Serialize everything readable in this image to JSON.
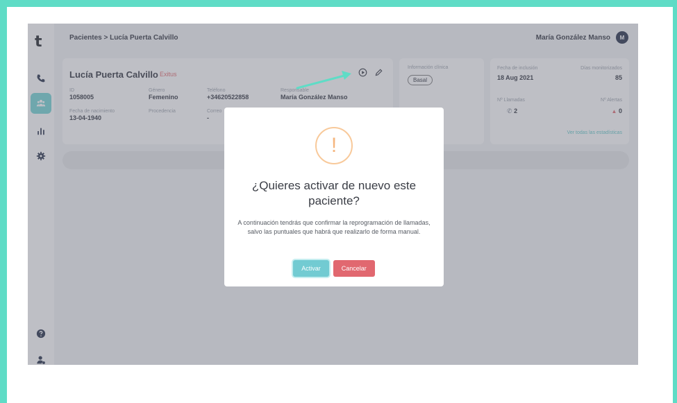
{
  "sidebar": {
    "logo": "t",
    "items": [
      {
        "name": "phone-icon"
      },
      {
        "name": "patients-icon",
        "active": true
      },
      {
        "name": "chart-icon"
      },
      {
        "name": "gear-icon"
      }
    ],
    "bottom_items": [
      {
        "name": "help-icon"
      },
      {
        "name": "user-settings-icon"
      }
    ]
  },
  "header": {
    "breadcrumb": "Pacientes > Lucía Puerta Calvillo",
    "user_name": "María González Manso",
    "avatar_initial": "M"
  },
  "patient": {
    "name": "Lucía Puerta Calvillo",
    "status": "Exitus",
    "fields": {
      "id_label": "ID",
      "id_value": "1058005",
      "gender_label": "Género",
      "gender_value": "Femenino",
      "phone_label": "Teléfono",
      "phone_value": "+34620522858",
      "responsible_label": "Responsable",
      "responsible_value": "María González Manso",
      "birth_label": "Fecha de nacimiento",
      "birth_value": "13-04-1940",
      "origin_label": "Procedencia",
      "email_label": "Correo",
      "email_value": "-"
    }
  },
  "clinical": {
    "title": "Información clínica",
    "tag": "Basal"
  },
  "stats": {
    "inclusion_label": "Fecha de inclusión",
    "inclusion_value": "18 Aug 2021",
    "days_label": "Días monitorizados",
    "days_value": "85",
    "calls_label": "Nº Llamadas",
    "calls_value": "2",
    "alerts_label": "Nº Alertas",
    "alerts_value": "0",
    "link": "Ver todas las estadísticas"
  },
  "modal": {
    "icon": "!",
    "title": "¿Quieres activar de nuevo este paciente?",
    "text": "A continuación tendrás que confirmar la reprogramación de llamadas, salvo las puntuales que habrá que realizarlo de forma manual.",
    "confirm_label": "Activar",
    "cancel_label": "Cancelar"
  },
  "colors": {
    "frame": "#5fdcc6",
    "accent": "#6fd3d3",
    "warning": "#f5b57d",
    "danger": "#e16870"
  }
}
